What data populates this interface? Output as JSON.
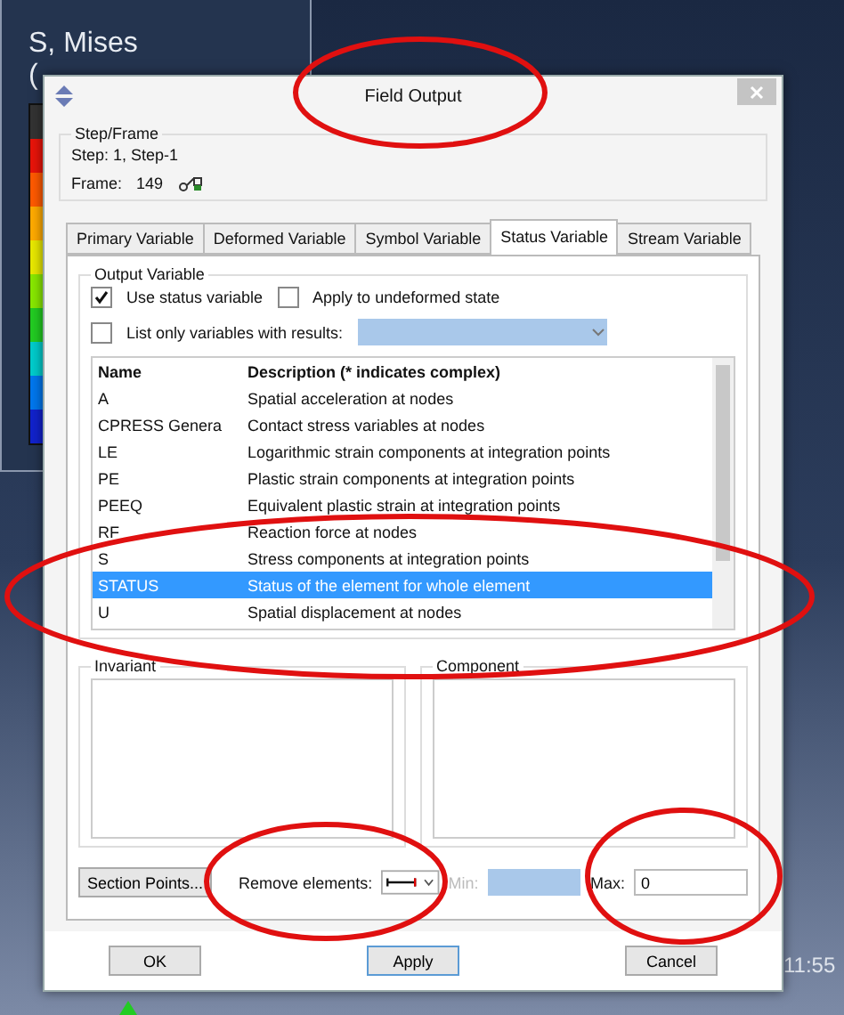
{
  "legend": {
    "title": "S, Mises",
    "subtitle": "(",
    "swatches": [
      {
        "color": "#333333"
      },
      {
        "color": "#e8140a"
      },
      {
        "color": "#ff5a00"
      },
      {
        "color": "#ffaa00"
      },
      {
        "color": "#e8e800"
      },
      {
        "color": "#88e800"
      },
      {
        "color": "#22cc22"
      },
      {
        "color": "#00cccc"
      },
      {
        "color": "#0077ee"
      },
      {
        "color": "#1122cc"
      }
    ]
  },
  "dialog": {
    "title": "Field Output",
    "step_frame": {
      "label": "Step/Frame",
      "step": "Step:  1, Step-1",
      "frame_label": "Frame:",
      "frame": "149"
    },
    "tabs": [
      {
        "label": "Primary Variable",
        "selected": false
      },
      {
        "label": "Deformed Variable",
        "selected": false
      },
      {
        "label": "Symbol Variable",
        "selected": false
      },
      {
        "label": "Status Variable",
        "selected": true
      },
      {
        "label": "Stream Variable",
        "selected": false
      }
    ],
    "output_variable": {
      "label": "Output Variable",
      "checks": [
        {
          "label": "Use status variable",
          "checked": true
        },
        {
          "label": "Apply to undeformed state",
          "checked": false
        },
        {
          "label": "List only variables with results:",
          "checked": false
        }
      ]
    },
    "table": {
      "columns": [
        "Name",
        "Description (* indicates complex)"
      ],
      "rows": [
        {
          "name": "A",
          "description": "Spatial acceleration at nodes",
          "selected": false
        },
        {
          "name": "CPRESS   Genera",
          "description": "Contact stress variables at nodes",
          "selected": false
        },
        {
          "name": "LE",
          "description": "Logarithmic strain components at integration points",
          "selected": false
        },
        {
          "name": "PE",
          "description": "Plastic strain components at integration points",
          "selected": false
        },
        {
          "name": "PEEQ",
          "description": "Equivalent plastic strain at integration points",
          "selected": false
        },
        {
          "name": "RF",
          "description": "Reaction force at nodes",
          "selected": false
        },
        {
          "name": "S",
          "description": "Stress components at integration points",
          "selected": false
        },
        {
          "name": "STATUS",
          "description": "Status of the element for whole element",
          "selected": true
        },
        {
          "name": "U",
          "description": "Spatial displacement at nodes",
          "selected": false
        }
      ]
    },
    "invariant_label": "Invariant",
    "component_label": "Component",
    "section_points": "Section Points...",
    "remove_label": "Remove elements:",
    "min_label": "Min:",
    "max_label": "Max:",
    "max_value": "0",
    "buttons": [
      "OK",
      "Apply",
      "Cancel"
    ]
  },
  "clock": "11:55"
}
